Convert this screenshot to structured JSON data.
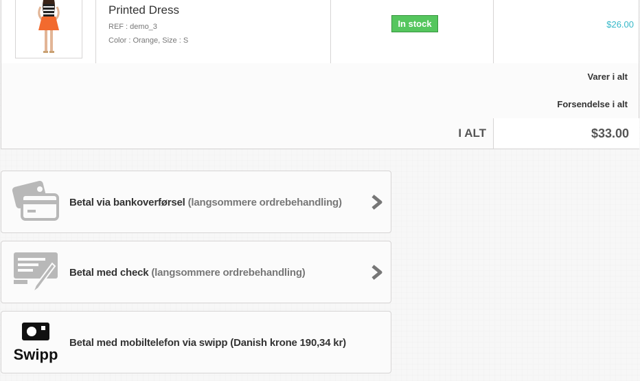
{
  "product": {
    "name": "Printed Dress",
    "ref": "REF : demo_3",
    "attributes": "Color : Orange, Size : S",
    "availability": "In stock",
    "price": "$26.00"
  },
  "summary": {
    "products_total_label": "Varer i alt",
    "shipping_total_label": "Forsendelse i alt",
    "grand_total_label": "I ALT",
    "grand_total_value": "$33.00"
  },
  "payment_options": [
    {
      "label": "Betal via bankoverførsel",
      "note": "(langsommere ordrebehandling)",
      "icon": "bank-card-icon"
    },
    {
      "label": "Betal med check",
      "note": "(langsommere ordrebehandling)",
      "icon": "check-pen-icon"
    },
    {
      "label": "Betal med mobiltelefon via swipp (Danish krone 190,34 kr)",
      "note": "",
      "icon": "swipp-logo",
      "logo_text": "Swipp"
    }
  ],
  "colors": {
    "in_stock_bg": "#55c65e",
    "price": "#35b8c8",
    "border": "#d6d4d4"
  }
}
